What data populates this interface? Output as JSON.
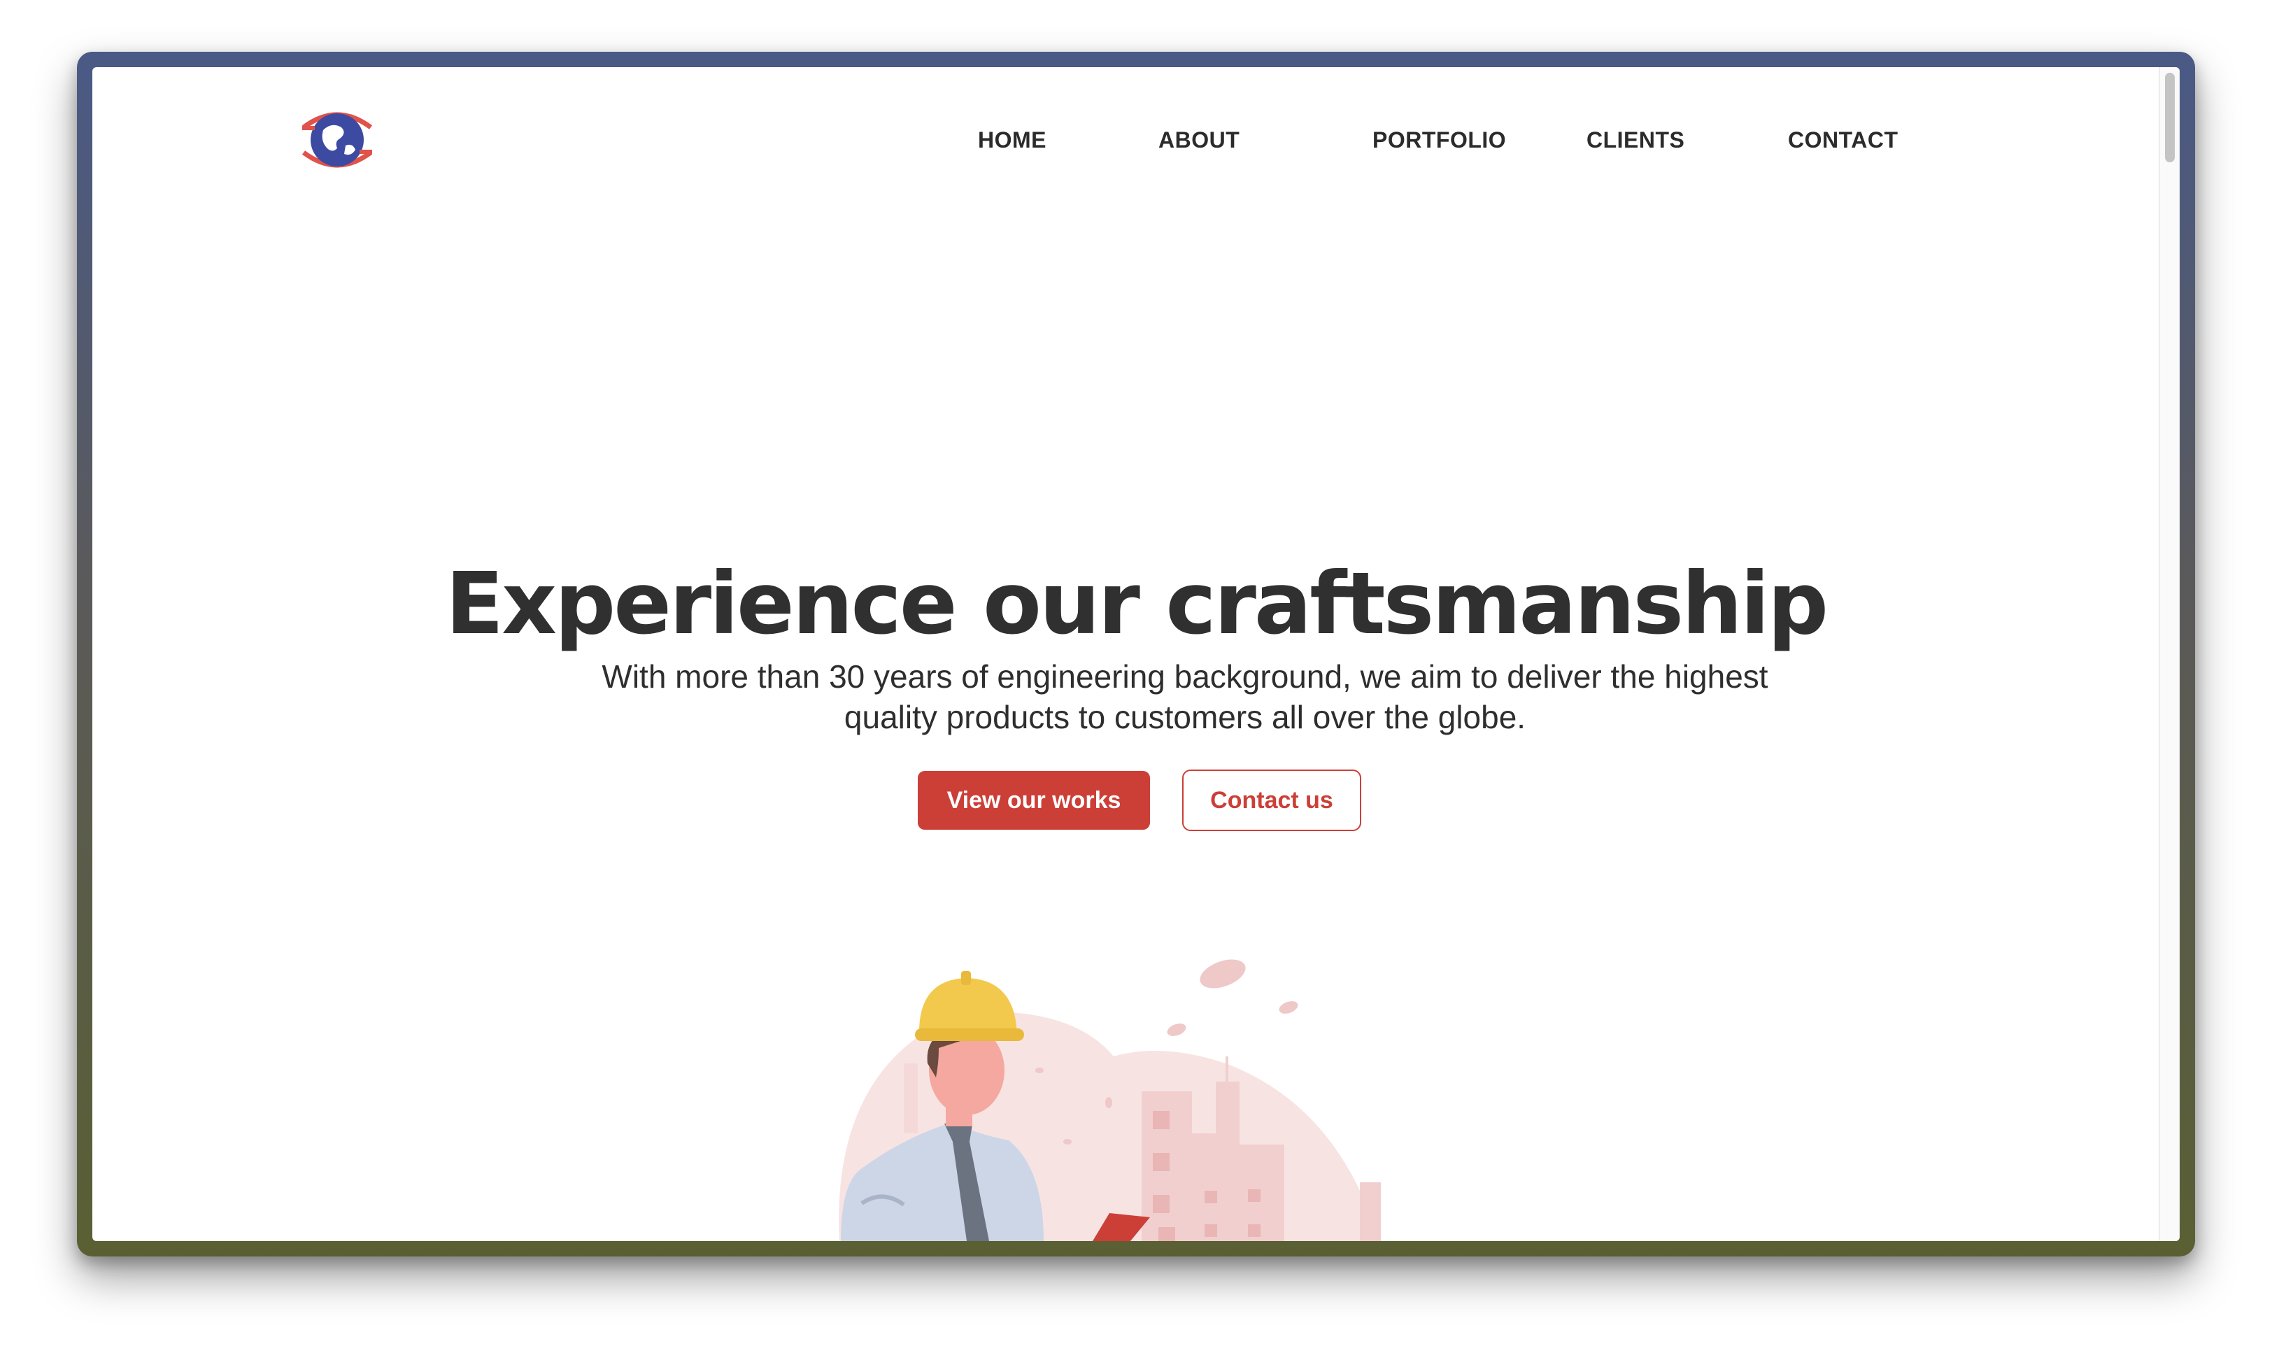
{
  "nav": {
    "items": [
      {
        "label": "HOME"
      },
      {
        "label": "ABOUT"
      },
      {
        "label": "PORTFOLIO"
      },
      {
        "label": "CLIENTS"
      },
      {
        "label": "CONTACT"
      }
    ]
  },
  "hero": {
    "title": "Experience our craftsmanship",
    "subtitle": "With more than 30 years of engineering background, we aim to deliver the highest quality products to customers all over the globe.",
    "primary_button": "View our works",
    "secondary_button": "Contact us"
  },
  "colors": {
    "accent": "#cc3f37",
    "text": "#303030",
    "logo_blue": "#3d4aa1",
    "helmet": "#f2c94c",
    "illustration_pink": "#f6dede"
  },
  "icons": {
    "logo": "globe-logo-icon",
    "illustration": "engineer-illustration"
  }
}
